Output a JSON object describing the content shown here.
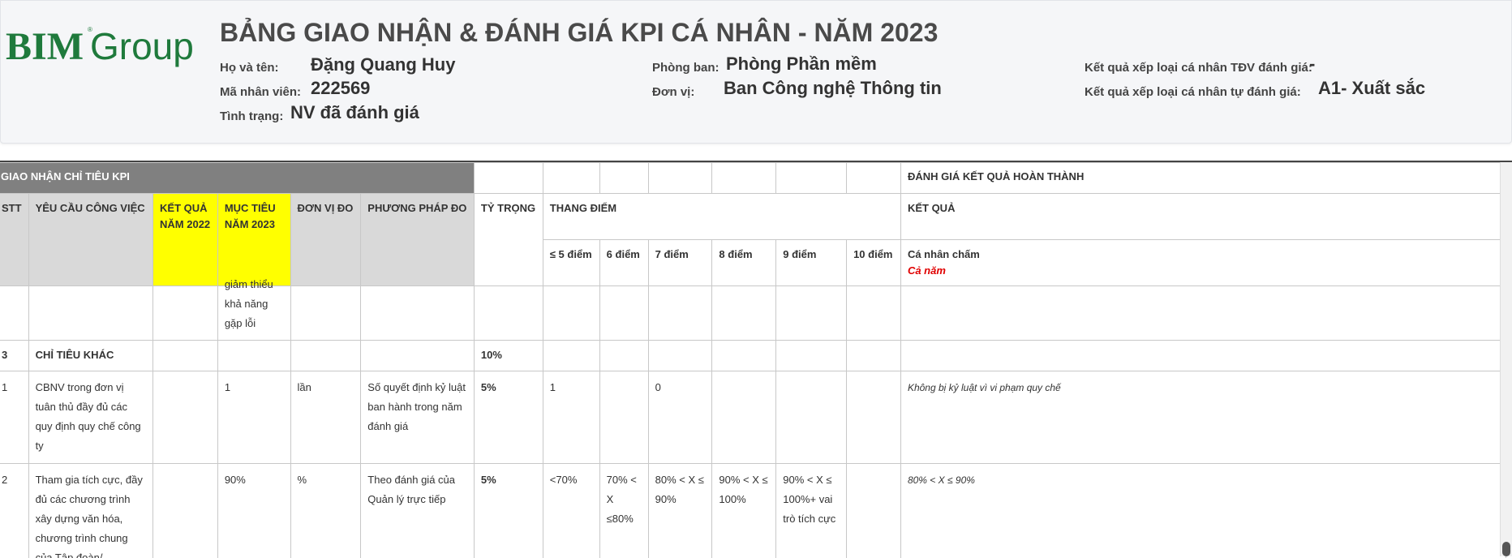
{
  "header": {
    "logo_text_bold": "BIM",
    "logo_text_light": "Group",
    "title": "BẢNG GIAO NHẬN & ĐÁNH GIÁ KPI CÁ NHÂN - NĂM 2023",
    "name_label": "Họ và tên:",
    "name_value": "Đặng Quang Huy",
    "id_label": "Mã nhân viên:",
    "id_value": "222569",
    "status_label": "Tình trạng:",
    "status_value": "NV đã đánh giá",
    "dept_label": "Phòng ban:",
    "dept_value": "Phòng Phần mềm",
    "unit_label": "Đơn vị:",
    "unit_value": "Ban Công nghệ Thông tin",
    "mgr_rating_label": "Kết quả xếp loại cá nhân TĐV đánh giá:",
    "mgr_rating_value": "-",
    "self_rating_label": "Kết quả xếp loại cá nhân tự đánh giá:",
    "self_rating_value": "A1- Xuất sắc"
  },
  "table": {
    "group_header_left": "GIAO NHẬN CHỈ TIÊU KPI",
    "group_header_right": "ĐÁNH GIÁ KẾT QUẢ HOÀN THÀNH",
    "col_stt": "STT",
    "col_requirement": "YÊU CẦU CÔNG VIỆC",
    "col_result_2022": "KẾT QUẢ NĂM 2022",
    "col_target_2023": "MỤC TIÊU NĂM 2023",
    "col_unit": "ĐƠN VỊ ĐO",
    "col_method": "PHƯƠNG PHÁP ĐO",
    "col_weight": "TỶ TRỌNG",
    "col_scale": "THANG ĐIỂM",
    "col_result": "KẾT QUẢ",
    "scale_5": "≤ 5 điểm",
    "scale_6": "6 điểm",
    "scale_7": "7 điểm",
    "scale_8": "8 điểm",
    "scale_9": "9 điểm",
    "scale_10": "10 điểm",
    "self_score": "Cá nhân chấm",
    "whole_year": "Cả năm",
    "row0": {
      "target": "giảm thiểu khả năng gặp lỗi"
    },
    "row_section": {
      "stt": "3",
      "requirement": "CHỈ TIÊU KHÁC",
      "weight": "10%"
    },
    "row1": {
      "stt": "1",
      "requirement": "CBNV trong đơn vị tuân thủ đầy đủ các quy định quy chế công ty",
      "target": "1",
      "unit": "lần",
      "method": "Số quyết định kỷ luật ban hành trong năm đánh giá",
      "weight": "5%",
      "s5": "1",
      "s7": "0",
      "result": "Không bị kỷ luật vì vi phạm quy chế"
    },
    "row2": {
      "stt": "2",
      "requirement": "Tham gia tích cực, đầy đủ các chương trình xây dựng văn hóa, chương trình chung của Tập đoàn/",
      "target": "90%",
      "unit": "%",
      "method": "Theo đánh giá của Quản lý trực tiếp",
      "weight": "5%",
      "s5": "<70%",
      "s6": "70% < X ≤80%",
      "s7": "80% < X ≤ 90%",
      "s8": "90% < X ≤ 100%",
      "s9": "90% < X ≤ 100%+ vai trò tích cực",
      "result": "80% < X ≤ 90%"
    }
  }
}
